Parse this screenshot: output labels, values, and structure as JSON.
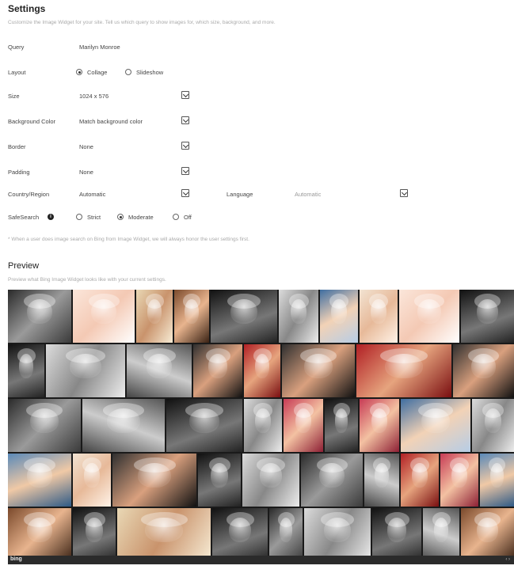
{
  "header": {
    "title": "Settings",
    "subtitle": "Customize the Image Widget for your site. Tell us which query to show images for, which size, background, and more."
  },
  "fields": {
    "query": {
      "label": "Query",
      "value": "Marilyn Monroe"
    },
    "layout": {
      "label": "Layout",
      "options": [
        "Collage",
        "Slideshow"
      ],
      "selected": "Collage"
    },
    "size": {
      "label": "Size",
      "value": "1024 x 576"
    },
    "background": {
      "label": "Background Color",
      "value": "Match background color"
    },
    "border": {
      "label": "Border",
      "value": "None"
    },
    "padding": {
      "label": "Padding",
      "value": "None"
    },
    "country": {
      "label": "Country/Region",
      "value": "Automatic"
    },
    "language": {
      "label": "Language",
      "value": "Automatic"
    },
    "safesearch": {
      "label": "SafeSearch",
      "options": [
        "Strict",
        "Moderate",
        "Off"
      ],
      "selected": "Moderate"
    }
  },
  "footnote": "* When a user does image search on Bing from Image Widget, we will always honor the user settings first.",
  "preview": {
    "title": "Preview",
    "subtitle": "Preview what Bing Image Widget looks like with your current settings.",
    "footer_logo": "bing",
    "pager": "‹ ›"
  },
  "icons": {
    "select_caret": "chevron-down-icon",
    "info": "info-icon"
  }
}
